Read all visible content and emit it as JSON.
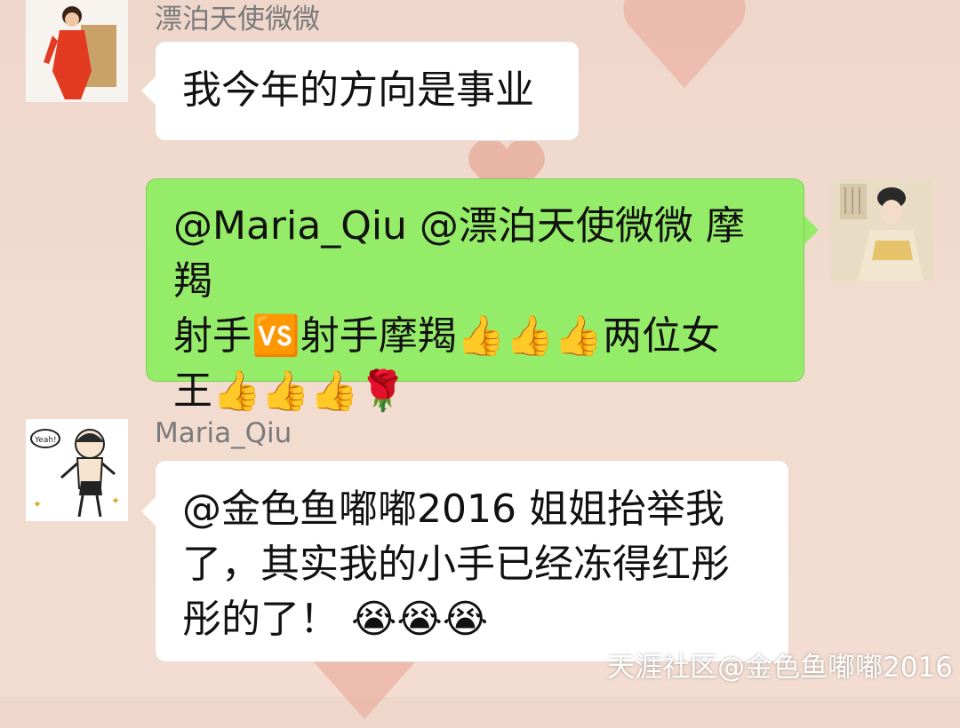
{
  "messages": [
    {
      "sender": "漂泊天使微微",
      "text": "我今年的方向是事业",
      "side": "left",
      "avatar": "woman-in-red-avatar"
    },
    {
      "sender": "",
      "lines": [
        "@Maria_Qiu @漂泊天使微微 摩羯",
        "射手🆚射手摩羯👍👍👍两位女",
        "王👍👍👍🌹"
      ],
      "side": "right",
      "avatar": "ancient-painting-woman-avatar"
    },
    {
      "sender": "Maria_Qiu",
      "lines": [
        "@金色鱼嘟嘟2016 姐姐抬举我",
        "了，其实我的小手已经冻得红彤",
        "彤的了！ 😭😭😭"
      ],
      "side": "left",
      "avatar": "cartoon-man-avatar"
    }
  ],
  "watermark": "天涯社区@金色鱼嘟嘟2016",
  "colors": {
    "background": "#f1dccf",
    "bubble_white": "#ffffff",
    "bubble_green": "#95ec69",
    "sender_text": "#7a7a7a"
  }
}
